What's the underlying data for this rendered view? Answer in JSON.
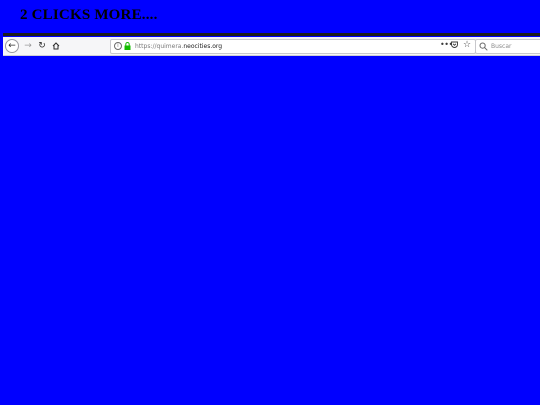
{
  "page": {
    "title": "2 CLICKS MORE....",
    "background_color": "#0000ff"
  },
  "browser": {
    "url": {
      "scheme": "https://quimera.",
      "host": "neocities.org"
    },
    "search": {
      "placeholder": "Buscar"
    },
    "icons": {
      "back": "back-arrow-icon",
      "forward": "forward-arrow-icon",
      "reload": "reload-icon",
      "home": "home-icon",
      "info": "info-icon",
      "lock": "lock-icon",
      "page_actions": "ellipsis-icon",
      "pocket": "pocket-icon",
      "bookmark": "star-icon",
      "search": "search-icon"
    }
  }
}
